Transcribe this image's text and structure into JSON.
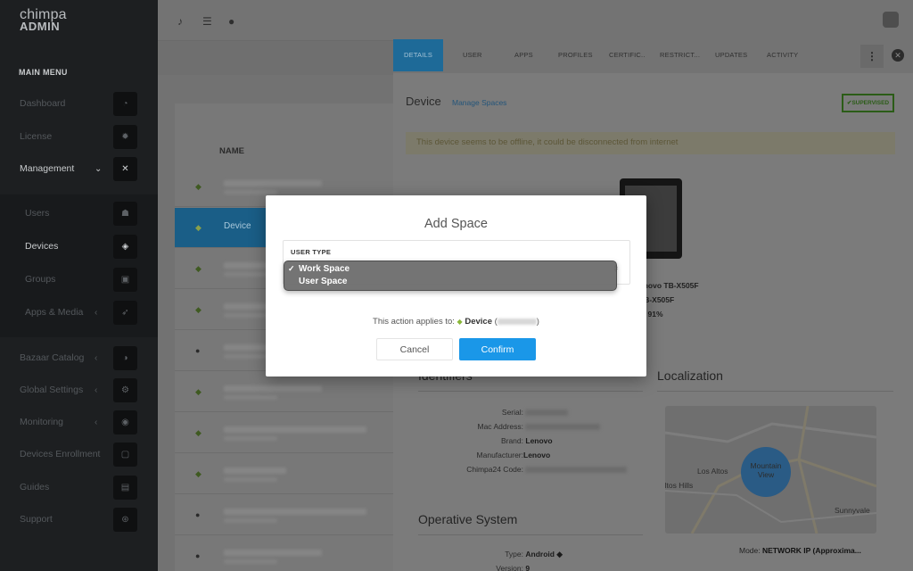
{
  "app": {
    "logo_line1": "chimpa",
    "logo_line2": "ADMIN"
  },
  "sidebar": {
    "menu_header": "MAIN MENU",
    "items": [
      {
        "label": "Dashboard",
        "icon": "speedometer-icon"
      },
      {
        "label": "License",
        "icon": "gear-icon"
      },
      {
        "label": "Management",
        "icon": "tools-icon",
        "chevron": "⌄"
      },
      {
        "label": "Users",
        "icon": "people-icon"
      },
      {
        "label": "Devices",
        "icon": "layers-icon"
      },
      {
        "label": "Groups",
        "icon": "groups-icon"
      },
      {
        "label": "Apps & Media",
        "icon": "rocket-icon",
        "chevron": "‹"
      },
      {
        "label": "Bazaar Catalog",
        "icon": "pie-icon",
        "chevron": "‹"
      },
      {
        "label": "Global Settings",
        "icon": "cogs-icon",
        "chevron": "‹"
      },
      {
        "label": "Monitoring",
        "icon": "eye-icon",
        "chevron": "‹"
      },
      {
        "label": "Devices Enrollment",
        "icon": "tablet-icon"
      },
      {
        "label": "Guides",
        "icon": "book-icon"
      },
      {
        "label": "Support",
        "icon": "lifebuoy-icon"
      }
    ]
  },
  "list": {
    "column_header": "NAME",
    "selected_name": "Device"
  },
  "detail": {
    "tabs": [
      "DETAILS",
      "USER",
      "APPS",
      "PROFILES",
      "CERTIFIC..",
      "RESTRICT...",
      "UPDATES",
      "ACTIVITY"
    ],
    "kebab": "⋮",
    "title": "Device",
    "manage_link": "Manage Spaces",
    "supervised_badge": "✔SUPERVISED",
    "offline_notice": "This device seems to be offline, it could be disconnected from internet",
    "spec_line1": "enovo TB-X505F",
    "spec_line2": "TB-X505F",
    "spec_line3": "⊕ 91%",
    "identifiers_title": "Identifiers",
    "identifiers": {
      "serial_label": "Serial:",
      "mac_label": "Mac Address:",
      "brand_label": "Brand:",
      "brand_value": "Lenovo",
      "manufacturer_label": "Manufacturer:",
      "manufacturer_value": "Lenovo",
      "code_label": "Chimpa24 Code:"
    },
    "os_title": "Operative System",
    "os": {
      "type_label": "Type:",
      "type_value": "Android ◆",
      "version_label": "Version:",
      "version_value": "9"
    },
    "localization_title": "Localization",
    "map_labels": {
      "los_altos": "Los Altos",
      "mountain_view": "Mountain View",
      "altos_hills": "Altos Hills",
      "sunnyvale": "Sunnyvale"
    },
    "mode_label": "Mode:",
    "mode_value": "NETWORK IP (Approxima..."
  },
  "modal": {
    "title": "Add Space",
    "field_label": "USER TYPE",
    "options": [
      {
        "label": "Work Space",
        "checked": true
      },
      {
        "label": "User Space",
        "checked": false
      }
    ],
    "applies_prefix": "This action applies to:",
    "applies_device": "Device",
    "cancel_label": "Cancel",
    "confirm_label": "Confirm"
  },
  "colors": {
    "accent": "#1a97e8",
    "sidebar_bg": "#1d1f21",
    "supervised_green": "#2b5c17"
  }
}
